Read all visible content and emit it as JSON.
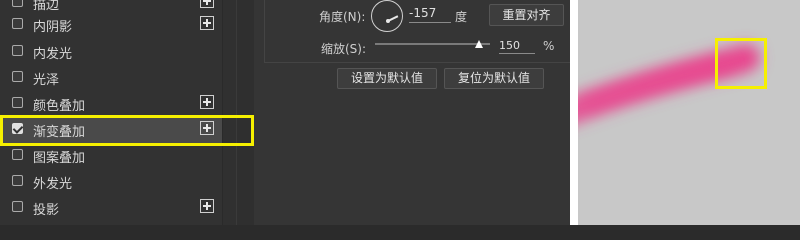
{
  "effects_list": [
    {
      "label": "描边",
      "checked": false,
      "has_plus": true
    },
    {
      "label": "内阴影",
      "checked": false,
      "has_plus": true
    },
    {
      "label": "内发光",
      "checked": false,
      "has_plus": false
    },
    {
      "label": "光泽",
      "checked": false,
      "has_plus": false
    },
    {
      "label": "颜色叠加",
      "checked": false,
      "has_plus": true
    },
    {
      "label": "渐变叠加",
      "checked": true,
      "has_plus": true,
      "selected": true
    },
    {
      "label": "图案叠加",
      "checked": false,
      "has_plus": false
    },
    {
      "label": "外发光",
      "checked": false,
      "has_plus": false
    },
    {
      "label": "投影",
      "checked": false,
      "has_plus": true
    }
  ],
  "settings": {
    "angle_label": "角度(N):",
    "angle_value": "-157",
    "angle_unit": "度",
    "reset_align_label": "重置对齐",
    "scale_label": "缩放(S):",
    "scale_value": "150",
    "scale_unit": "%",
    "scale_fraction": 0.9,
    "set_default_label": "设置为默认值",
    "reset_default_label": "复位为默认值"
  },
  "preview": {
    "background_color": "#c8c8c8",
    "stroke_color": "#e8478f"
  },
  "highlight_color": "#f6f000"
}
